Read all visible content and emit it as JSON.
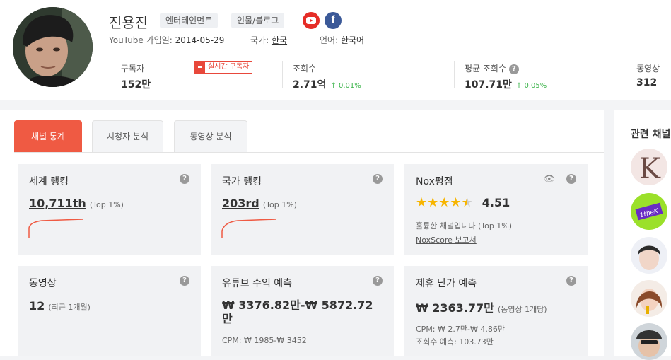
{
  "channel": {
    "name": "진용진",
    "tags": [
      "엔터테인먼트",
      "인물/블로그"
    ],
    "joined_label": "YouTube 가입일:",
    "joined_value": "2014-05-29",
    "country_label": "국가:",
    "country_value": "한국",
    "language_label": "언어:",
    "language_value": "한국어"
  },
  "stats": {
    "subscribers": {
      "label": "구독자",
      "value": "152만",
      "live_label": "실시간 구독자"
    },
    "views": {
      "label": "조회수",
      "value": "2.71억",
      "change": "0.01%"
    },
    "avg_views": {
      "label": "평균 조회수",
      "value": "107.71만",
      "change": "0.05%"
    },
    "videos": {
      "label": "동영상",
      "value": "312"
    }
  },
  "tabs": [
    "채널 통계",
    "시청자 분석",
    "동영상 분석"
  ],
  "cards": {
    "world_rank": {
      "title": "세계 랭킹",
      "value": "10,711th",
      "sub": "(Top 1%)"
    },
    "country_rank": {
      "title": "국가 랭킹",
      "value": "203rd",
      "sub": "(Top 1%)"
    },
    "nox": {
      "title": "Nox평점",
      "score": "4.51",
      "rating": 4.5,
      "desc": "훌륭한 채널입니다 (Top 1%)",
      "link": "NoxScore 보고서"
    },
    "videos": {
      "title": "동영상",
      "value": "12",
      "sub": "(최근 1개월)"
    },
    "revenue": {
      "title": "유튜브 수익 예측",
      "value": "₩ 3376.82만-₩ 5872.72만",
      "cpm": "CPM: ₩ 1985-₩ 3452"
    },
    "partner": {
      "title": "제휴 단가 예측",
      "value": "₩ 2363.77만",
      "sub": "(동영상 1개당)",
      "cpm": "CPM: ₩ 2.7만-₩ 4.86만",
      "views": "조회수 예측: 103.73만"
    }
  },
  "related": {
    "title": "관련 채널"
  },
  "colors": {
    "accent": "#ef5a43",
    "positive": "#3cb44b",
    "star": "#f7b500"
  }
}
